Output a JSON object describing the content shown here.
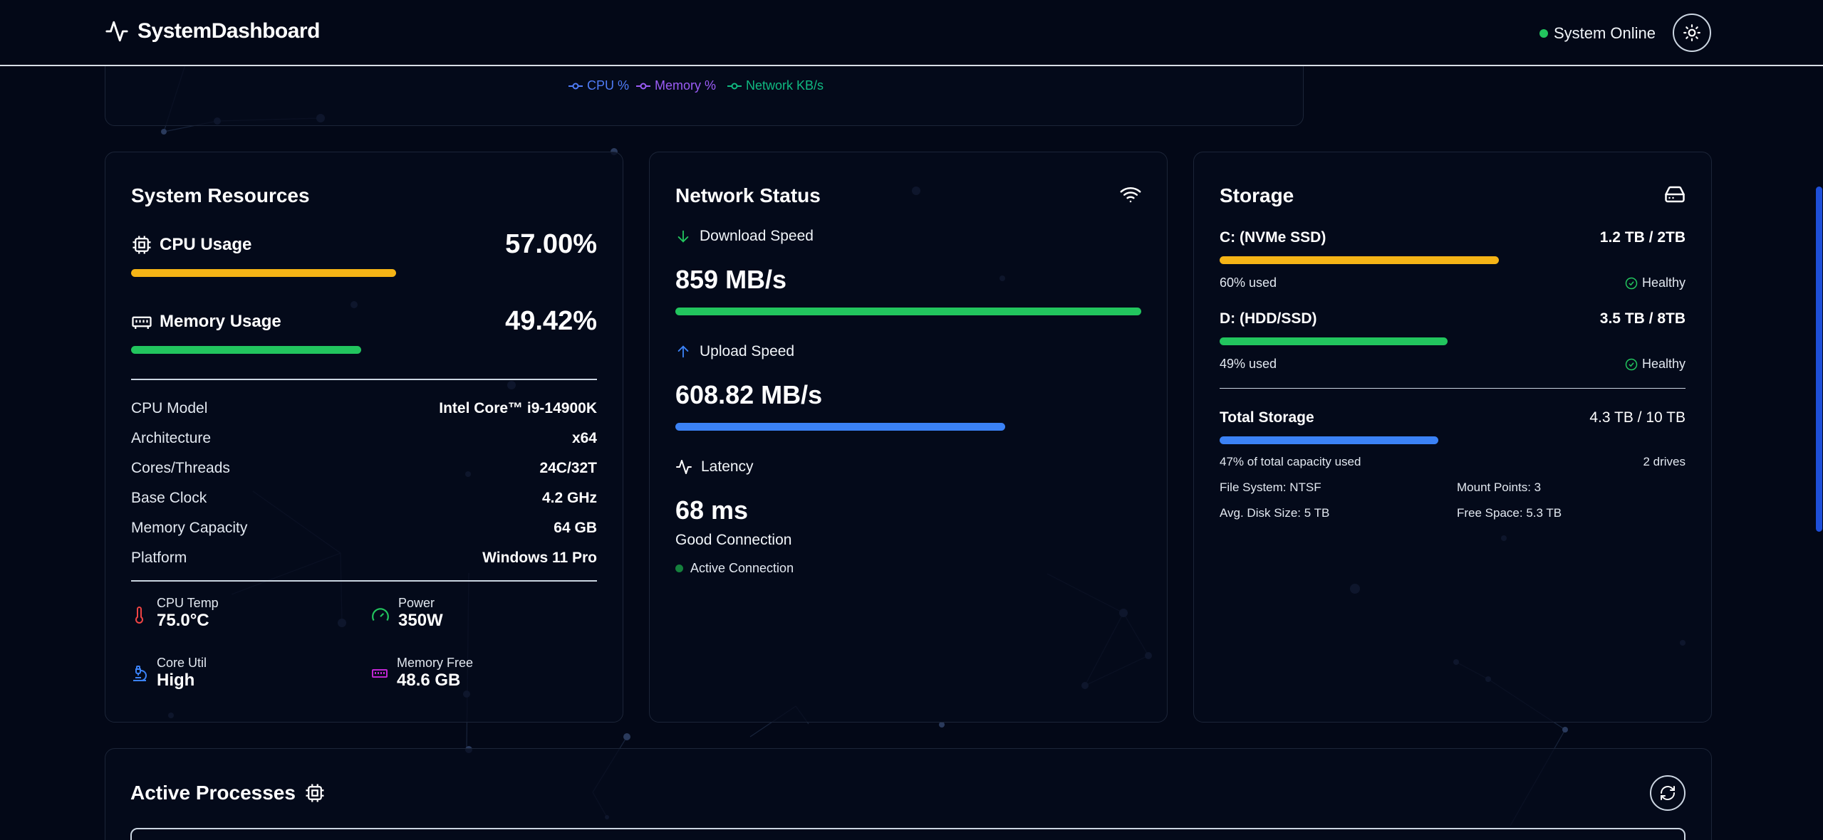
{
  "header": {
    "title": "SystemDashboard",
    "status": "System Online"
  },
  "chart_legend": {
    "items": [
      {
        "label": "CPU %",
        "color": "#4f7cf7"
      },
      {
        "label": "Memory %",
        "color": "#9b5cf6"
      },
      {
        "label": "Network KB/s",
        "color": "#10b981"
      }
    ]
  },
  "resources": {
    "title": "System Resources",
    "cpu": {
      "label": "CPU Usage",
      "value": "57.00%",
      "percent": 57,
      "color": "#f5b416"
    },
    "memory": {
      "label": "Memory Usage",
      "value": "49.42%",
      "percent": 49.42,
      "color": "#22c55e"
    },
    "specs": [
      {
        "label": "CPU Model",
        "value": "Intel Core™ i9-14900K"
      },
      {
        "label": "Architecture",
        "value": "x64"
      },
      {
        "label": "Cores/Threads",
        "value": "24C/32T"
      },
      {
        "label": "Base Clock",
        "value": "4.2 GHz"
      },
      {
        "label": "Memory Capacity",
        "value": "64 GB"
      },
      {
        "label": "Platform",
        "value": "Windows 11 Pro"
      }
    ],
    "mini": [
      {
        "label": "CPU Temp",
        "value": "75.0°C",
        "icon": "thermometer-icon",
        "color": "#ef4444"
      },
      {
        "label": "Power",
        "value": "350W",
        "icon": "gauge-icon",
        "color": "#22c55e"
      },
      {
        "label": "Core Util",
        "value": "High",
        "icon": "microscope-icon",
        "color": "#3b82f6"
      },
      {
        "label": "Memory Free",
        "value": "48.6 GB",
        "icon": "memory-icon",
        "color": "#c026d3"
      }
    ]
  },
  "network": {
    "title": "Network Status",
    "download": {
      "label": "Download Speed",
      "value": "859 MB/s",
      "fill": 1.0,
      "color": "#22c55e"
    },
    "upload": {
      "label": "Upload Speed",
      "value": "608.82 MB/s",
      "fill": 0.708,
      "color": "#3b82f6"
    },
    "latency": {
      "label": "Latency",
      "value": "68 ms"
    },
    "quality": "Good Connection",
    "active": "Active Connection"
  },
  "storage": {
    "title": "Storage",
    "drives": [
      {
        "name": "C: (NVMe SSD)",
        "capacity": "1.2 TB / 2TB",
        "used_text": "60% used",
        "percent": 60,
        "status": "Healthy",
        "color": "#f5b416"
      },
      {
        "name": "D: (HDD/SSD)",
        "capacity": "3.5 TB / 8TB",
        "used_text": "49% used",
        "percent": 49,
        "status": "Healthy",
        "color": "#22c55e"
      }
    ],
    "total": {
      "label": "Total Storage",
      "value": "4.3 TB / 10 TB",
      "percent": 47,
      "caption": "47% of total capacity used",
      "drives": "2 drives",
      "color": "#3b82f6"
    },
    "info": {
      "file_system": "File System: NTSF",
      "mount_points": "Mount Points: 3",
      "avg_size": "Avg. Disk Size: 5 TB",
      "free_space": "Free Space: 5.3 TB"
    }
  },
  "processes": {
    "title": "Active Processes"
  }
}
